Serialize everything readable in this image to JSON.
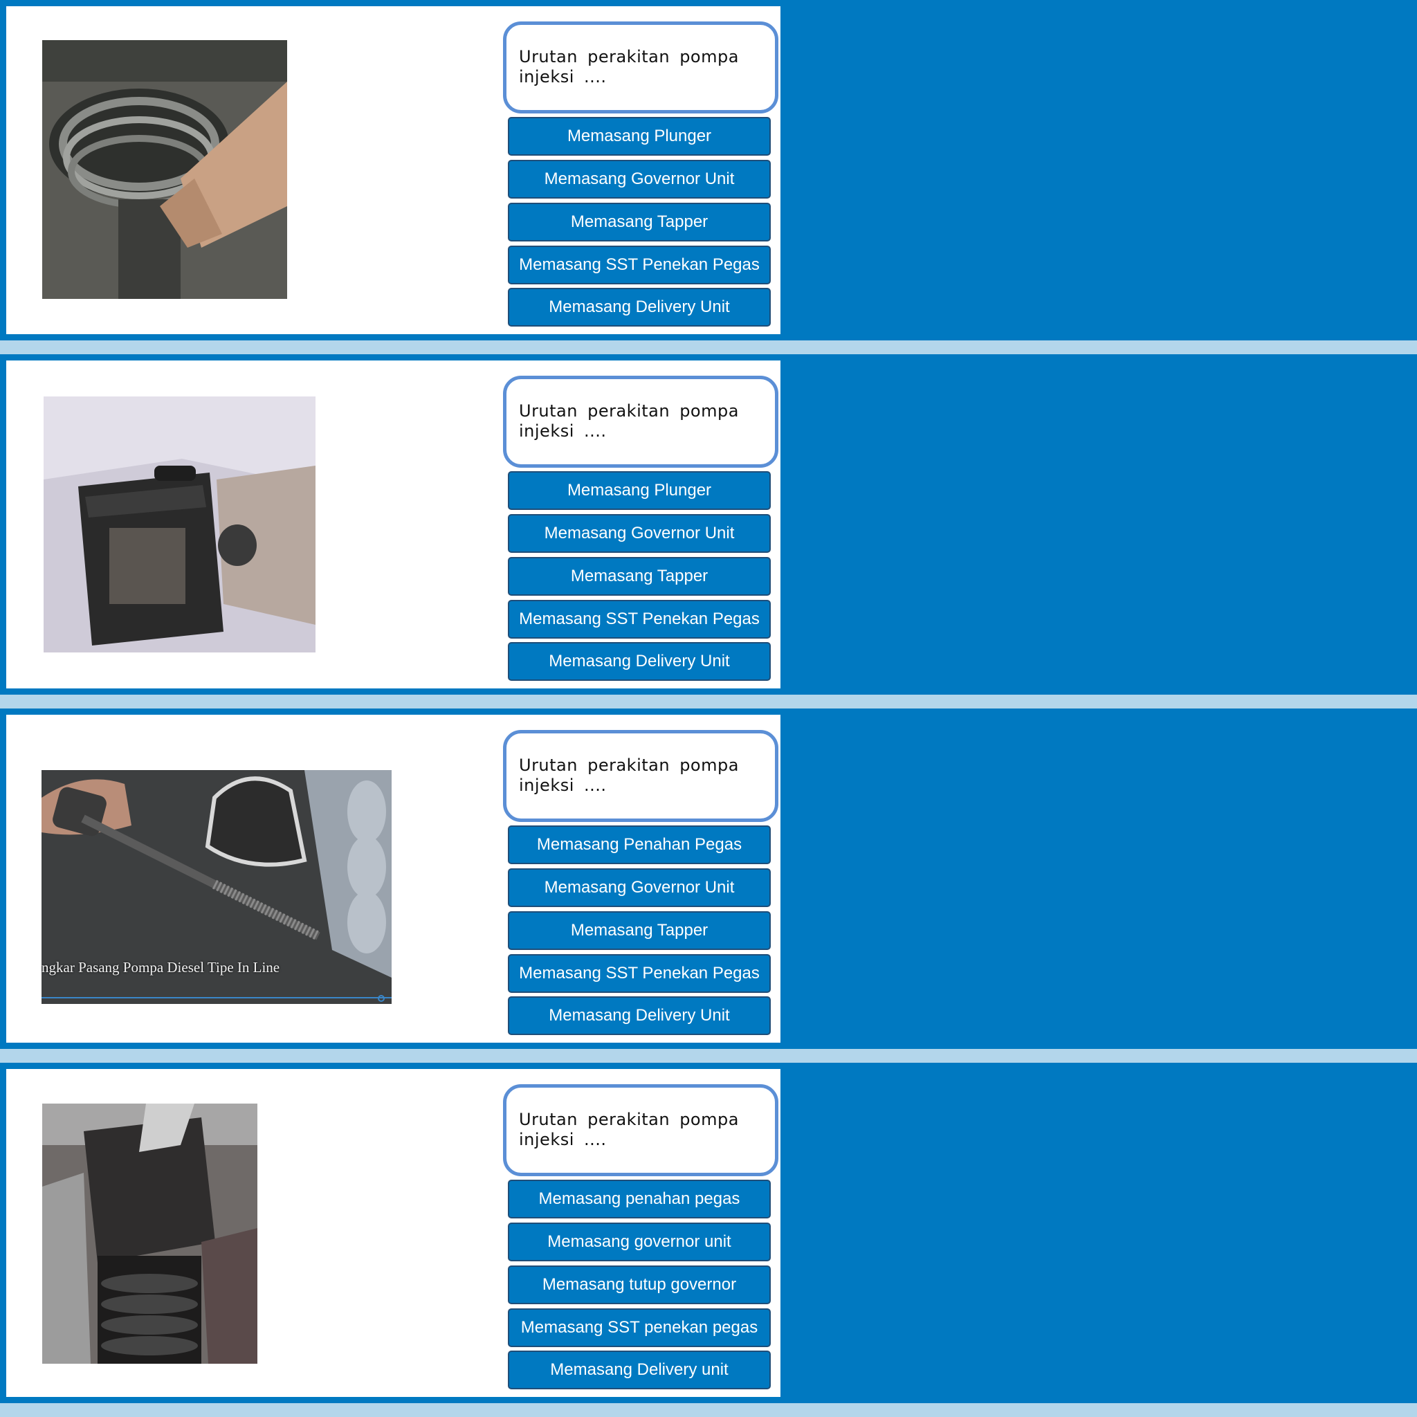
{
  "colors": {
    "background": "#0079c1",
    "separator": "#b3d6eb",
    "card": "#ffffff",
    "question_border": "#5b8fd6",
    "button_fill": "#0079c1",
    "button_border": "#1f4e79"
  },
  "slides": [
    {
      "image": "spring-plunger-photo",
      "question": "Urutan perakitan pompa injeksi ....",
      "options": [
        "Memasang Plunger",
        "Memasang Governor Unit",
        "Memasang Tapper",
        "Memasang SST Penekan Pegas",
        "Memasang Delivery Unit"
      ]
    },
    {
      "image": "tappet-block-photo",
      "question": "Urutan perakitan pompa injeksi ....",
      "options": [
        "Memasang Plunger",
        "Memasang Governor Unit",
        "Memasang Tapper",
        "Memasang SST Penekan Pegas",
        "Memasang Delivery Unit"
      ]
    },
    {
      "image": "sst-tool-video-frame",
      "video_caption": "ngkar Pasang Pompa Diesel Tipe In Line",
      "question": "Urutan perakitan pompa injeksi ....",
      "options": [
        "Memasang Penahan Pegas",
        "Memasang Governor Unit",
        "Memasang Tapper",
        "Memasang SST Penekan Pegas",
        "Memasang Delivery Unit"
      ]
    },
    {
      "image": "spring-retainer-photo",
      "question": "Urutan perakitan pompa injeksi ....",
      "options": [
        "Memasang penahan pegas",
        "Memasang governor unit",
        "Memasang tutup governor",
        "Memasang SST penekan pegas",
        "Memasang Delivery unit"
      ]
    }
  ]
}
